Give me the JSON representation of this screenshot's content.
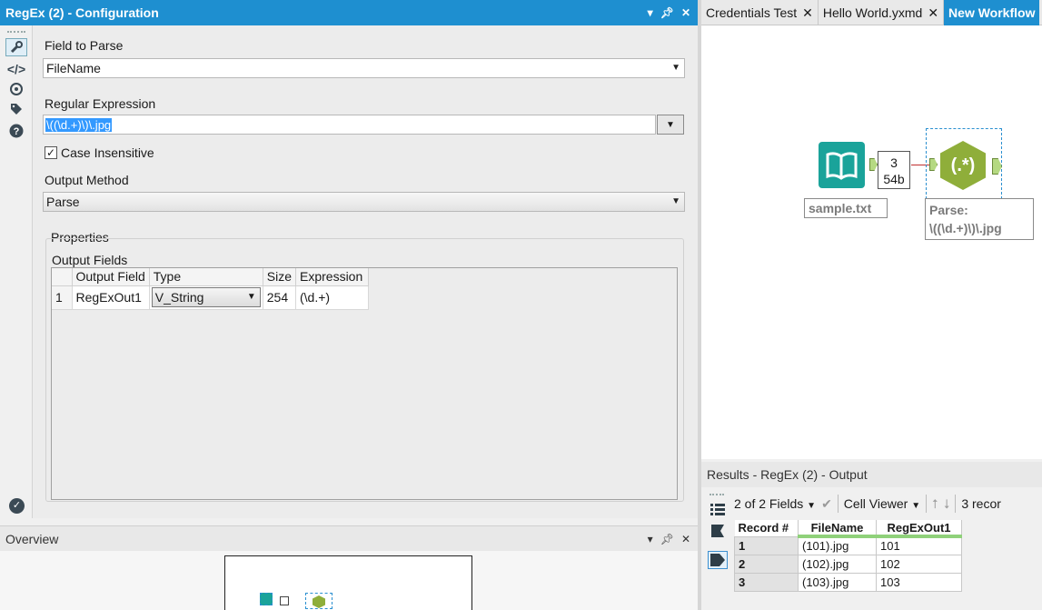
{
  "config": {
    "title": "RegEx (2) - Configuration",
    "field_to_parse_label": "Field to Parse",
    "field_to_parse_value": "FileName",
    "regex_label": "Regular Expression",
    "regex_value": "\\((\\d.+)\\)\\.jpg",
    "case_insensitive_label": "Case Insensitive",
    "case_insensitive_checked": true,
    "output_method_label": "Output Method",
    "output_method_value": "Parse",
    "properties_label": "Properties",
    "output_fields_label": "Output Fields",
    "columns": [
      "Output Field",
      "Type",
      "Size",
      "Expression"
    ],
    "rows": [
      {
        "index": "1",
        "output_field": "RegExOut1",
        "type": "V_String",
        "size": "254",
        "expression": "(\\d.+)"
      }
    ]
  },
  "overview": {
    "title": "Overview"
  },
  "tabs": [
    {
      "label": "Credentials Test"
    },
    {
      "label": "Hello World.yxmd"
    },
    {
      "label": "New Workflow"
    }
  ],
  "canvas": {
    "input_tool_label": "sample.txt",
    "record_count": "3",
    "record_size": "54b",
    "regex_tool_symbol": "(.*)",
    "parse_annotation_line1": "Parse:",
    "parse_annotation_line2": "\\((\\d.+)\\)\\.jpg"
  },
  "results": {
    "title": "Results - RegEx (2) - Output",
    "fields_selector": "2 of 2 Fields",
    "cell_viewer": "Cell Viewer",
    "record_count_text": "3 recor",
    "columns": [
      "Record #",
      "FileName",
      "RegExOut1"
    ],
    "rows": [
      {
        "record": "1",
        "filename": "(101).jpg",
        "out": "101"
      },
      {
        "record": "2",
        "filename": "(102).jpg",
        "out": "102"
      },
      {
        "record": "3",
        "filename": "(103).jpg",
        "out": "103"
      }
    ]
  },
  "colors": {
    "accent": "#1e8fd0",
    "tool_green": "#8fae3a",
    "tool_teal": "#1aa39a",
    "header_underline": "#8fd17a"
  }
}
